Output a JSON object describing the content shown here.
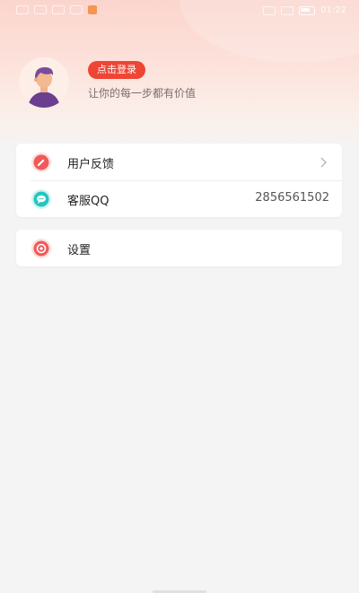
{
  "status_bar": {
    "time": "01:22",
    "battery": "90"
  },
  "profile": {
    "login_label": "点击登录",
    "slogan": "让你的每一步都有价值"
  },
  "menu": {
    "feedback_label": "用户反馈",
    "qq_label": "客服QQ",
    "qq_value": "2856561502",
    "settings_label": "设置"
  },
  "colors": {
    "accent": "#ef4534",
    "feedback_icon": "#ef5a5a",
    "qq_icon": "#25c4c0",
    "settings_icon": "#ef5a5a"
  },
  "icons": {
    "feedback": "edit-icon",
    "qq": "chat-bubble-icon",
    "settings": "target-icon",
    "chevron": "chevron-right-icon"
  }
}
